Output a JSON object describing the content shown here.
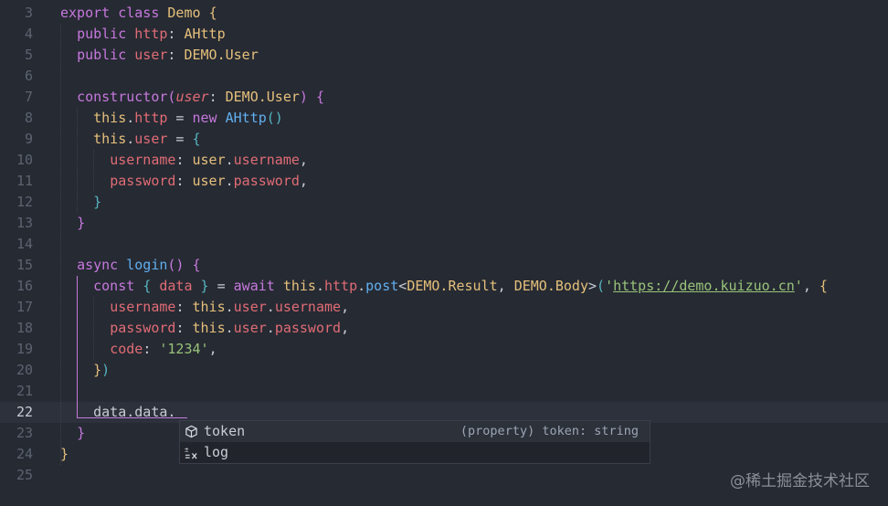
{
  "editor": {
    "lines": [
      {
        "n": "3",
        "t": [
          [
            "export ",
            "kw"
          ],
          [
            "class ",
            "kw"
          ],
          [
            "Demo ",
            "cls"
          ],
          [
            "{",
            "brace1"
          ]
        ]
      },
      {
        "n": "4",
        "t": [
          [
            "  "
          ],
          [
            "public ",
            "kw"
          ],
          [
            "http",
            "prop"
          ],
          [
            ": "
          ],
          [
            "AHttp",
            "cls"
          ]
        ]
      },
      {
        "n": "5",
        "t": [
          [
            "  "
          ],
          [
            "public ",
            "kw"
          ],
          [
            "user",
            "prop"
          ],
          [
            ": "
          ],
          [
            "DEMO.User",
            "cls"
          ]
        ]
      },
      {
        "n": "6",
        "t": []
      },
      {
        "n": "7",
        "t": [
          [
            "  "
          ],
          [
            "constructor",
            "kw"
          ],
          [
            "(",
            "brace2"
          ],
          [
            "user",
            "param"
          ],
          [
            ": "
          ],
          [
            "DEMO.User",
            "cls"
          ],
          [
            ") ",
            "brace2"
          ],
          [
            "{",
            "brace2"
          ]
        ]
      },
      {
        "n": "8",
        "t": [
          [
            "    "
          ],
          [
            "this",
            "cls"
          ],
          [
            "."
          ],
          [
            "http",
            "prop"
          ],
          [
            " = "
          ],
          [
            "new ",
            "kw"
          ],
          [
            "AHttp",
            "fn"
          ],
          [
            "()",
            "brace3"
          ]
        ]
      },
      {
        "n": "9",
        "t": [
          [
            "    "
          ],
          [
            "this",
            "cls"
          ],
          [
            "."
          ],
          [
            "user",
            "prop"
          ],
          [
            " = "
          ],
          [
            "{",
            "brace3"
          ]
        ]
      },
      {
        "n": "10",
        "t": [
          [
            "      "
          ],
          [
            "username",
            "prop"
          ],
          [
            ": "
          ],
          [
            "user",
            "cls"
          ],
          [
            "."
          ],
          [
            "username",
            "prop"
          ],
          [
            ","
          ]
        ]
      },
      {
        "n": "11",
        "t": [
          [
            "      "
          ],
          [
            "password",
            "prop"
          ],
          [
            ": "
          ],
          [
            "user",
            "cls"
          ],
          [
            "."
          ],
          [
            "password",
            "prop"
          ],
          [
            ","
          ]
        ]
      },
      {
        "n": "12",
        "t": [
          [
            "    "
          ],
          [
            "}",
            "brace3"
          ]
        ]
      },
      {
        "n": "13",
        "t": [
          [
            "  "
          ],
          [
            "}",
            "brace2"
          ]
        ]
      },
      {
        "n": "14",
        "t": []
      },
      {
        "n": "15",
        "t": [
          [
            "  "
          ],
          [
            "async ",
            "kw"
          ],
          [
            "login",
            "fn"
          ],
          [
            "() ",
            "brace2"
          ],
          [
            "{",
            "brace2"
          ]
        ]
      },
      {
        "n": "16",
        "t": [
          [
            "    "
          ],
          [
            "const ",
            "kw"
          ],
          [
            "{ ",
            "brace3"
          ],
          [
            "data",
            "prop"
          ],
          [
            " } ",
            "brace3"
          ],
          [
            "= "
          ],
          [
            "await ",
            "kw"
          ],
          [
            "this",
            "cls"
          ],
          [
            "."
          ],
          [
            "http",
            "prop"
          ],
          [
            "."
          ],
          [
            "post",
            "fn"
          ],
          [
            "<"
          ],
          [
            "DEMO.Result",
            "cls"
          ],
          [
            ", "
          ],
          [
            "DEMO.Body",
            "cls"
          ],
          [
            ">"
          ],
          [
            "(",
            "brace3"
          ],
          [
            "'",
            "str"
          ],
          [
            "https://demo.kuizuo.cn",
            "url"
          ],
          [
            "'",
            "str"
          ],
          [
            ", "
          ],
          [
            "{",
            "brace1"
          ]
        ]
      },
      {
        "n": "17",
        "t": [
          [
            "      "
          ],
          [
            "username",
            "prop"
          ],
          [
            ": "
          ],
          [
            "this",
            "cls"
          ],
          [
            "."
          ],
          [
            "user",
            "prop"
          ],
          [
            "."
          ],
          [
            "username",
            "prop"
          ],
          [
            ","
          ]
        ]
      },
      {
        "n": "18",
        "t": [
          [
            "      "
          ],
          [
            "password",
            "prop"
          ],
          [
            ": "
          ],
          [
            "this",
            "cls"
          ],
          [
            "."
          ],
          [
            "user",
            "prop"
          ],
          [
            "."
          ],
          [
            "password",
            "prop"
          ],
          [
            ","
          ]
        ]
      },
      {
        "n": "19",
        "t": [
          [
            "      "
          ],
          [
            "code",
            "prop"
          ],
          [
            ": "
          ],
          [
            "'1234'",
            "str"
          ],
          [
            ","
          ]
        ]
      },
      {
        "n": "20",
        "t": [
          [
            "    "
          ],
          [
            "}",
            "brace1"
          ],
          [
            ")",
            "brace3"
          ]
        ]
      },
      {
        "n": "21",
        "t": []
      },
      {
        "n": "22",
        "t": [
          [
            "    "
          ],
          [
            "data.data."
          ]
        ],
        "current": true
      },
      {
        "n": "23",
        "t": [
          [
            "  "
          ],
          [
            "}",
            "brace2"
          ]
        ]
      },
      {
        "n": "24",
        "t": [
          [
            "}",
            "brace1"
          ]
        ]
      },
      {
        "n": "25",
        "t": []
      }
    ]
  },
  "suggestions": [
    {
      "icon": "property-icon",
      "label": "token",
      "detail": "(property) token: string",
      "selected": true
    },
    {
      "icon": "method-icon",
      "label": "log",
      "detail": "",
      "selected": false
    }
  ],
  "watermark": "@稀土掘金技术社区",
  "colors": {
    "background": "#262a33",
    "keyword": "#c678dd",
    "string": "#98c379",
    "property": "#e06c75",
    "function": "#61afef"
  }
}
